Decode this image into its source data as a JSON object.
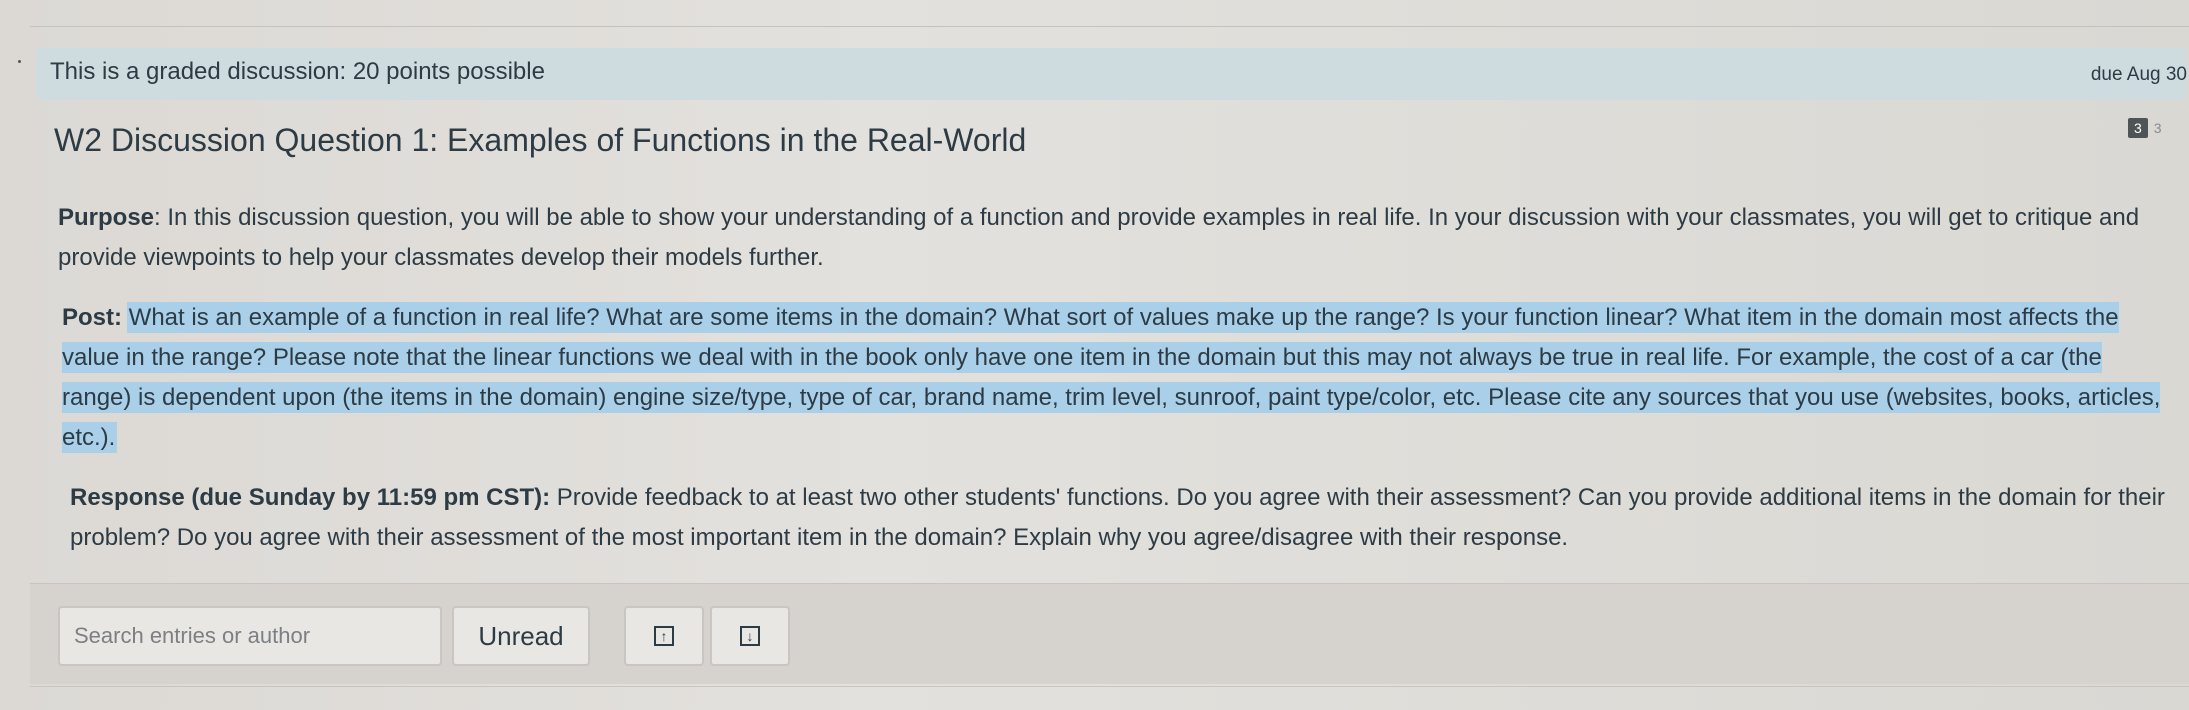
{
  "banner": {
    "graded_text": "This is a graded discussion: 20 points possible",
    "due": "due Aug 30"
  },
  "badges": {
    "unread": "3",
    "total": "3"
  },
  "title": "W2 Discussion Question 1: Examples of Functions in the Real-World",
  "purpose": {
    "label": "Purpose",
    "text": ": In this discussion question, you will be able to show your understanding of a function and provide examples in real life. In your discussion with your classmates, you will get to critique and provide viewpoints to help your classmates develop their models further."
  },
  "post": {
    "label": "Post:",
    "text": "What is an example of a function in real life? What are some items in the domain? What sort of values make up the range? Is your function linear? What item in the domain most affects the value in the range? Please note that the linear functions we deal with in the book only have one item in the domain but this may not always be true in real life. For example, the cost of a car (the range) is dependent upon (the items in the domain) engine size/type, type of car, brand name,  trim level, sunroof, paint type/color, etc. Please cite any sources that you use (websites, books, articles, etc.)."
  },
  "response": {
    "label": "Response (due Sunday by 11:59 pm CST):",
    "text": " Provide feedback to at least two other students' functions. Do you agree with their assessment? Can you provide additional items in the domain for their problem? Do you agree with their assessment of the most important item in the domain? Explain why you agree/disagree with their response."
  },
  "toolbar": {
    "search_placeholder": "Search entries or author",
    "unread_label": "Unread",
    "expand_icon": "arrow-up-box-icon",
    "collapse_icon": "arrow-down-box-icon"
  },
  "colors": {
    "banner_bg": "#cfdcdf",
    "highlight": "#a9cfe9",
    "text": "#2d3b45"
  }
}
